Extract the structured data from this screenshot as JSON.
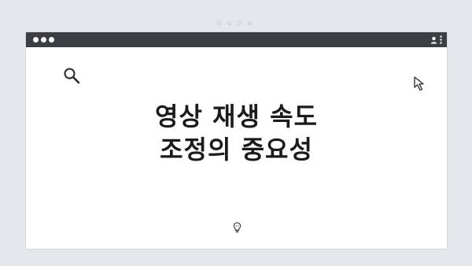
{
  "headline": {
    "line1": "영상 재생 속도",
    "line2": "조정의 중요성"
  },
  "icons": {
    "search": "search-icon",
    "cursor": "cursor-arrow-icon",
    "lightbulb": "lightbulb-icon",
    "user": "user-icon",
    "menu": "kebab-menu-icon"
  },
  "colors": {
    "background": "#e3e7eb",
    "titlebar": "#3b3e42",
    "window": "#ffffff",
    "text": "#1b1b1b"
  }
}
